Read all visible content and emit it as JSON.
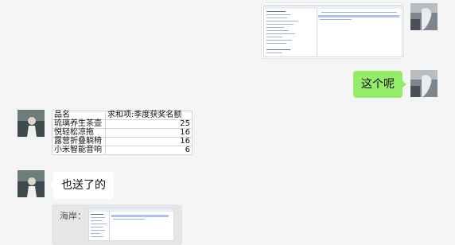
{
  "messages": {
    "sent_text": "这个呢",
    "received_text": "也送了的",
    "quote_sender": "海岸："
  },
  "sheet": {
    "headers": [
      "品名",
      "求和项:季度获奖名额"
    ],
    "rows": [
      {
        "name": "琉璃养生茶壶",
        "value": "25"
      },
      {
        "name": "悦轻松凉拖",
        "value": "16"
      },
      {
        "name": "露营折叠躺椅",
        "value": "16"
      },
      {
        "name": "小米智能音响",
        "value": "6"
      }
    ]
  },
  "colors": {
    "sent_bubble": "#95ec69",
    "received_bubble": "#ffffff",
    "chat_background": "#f5f5f5"
  }
}
